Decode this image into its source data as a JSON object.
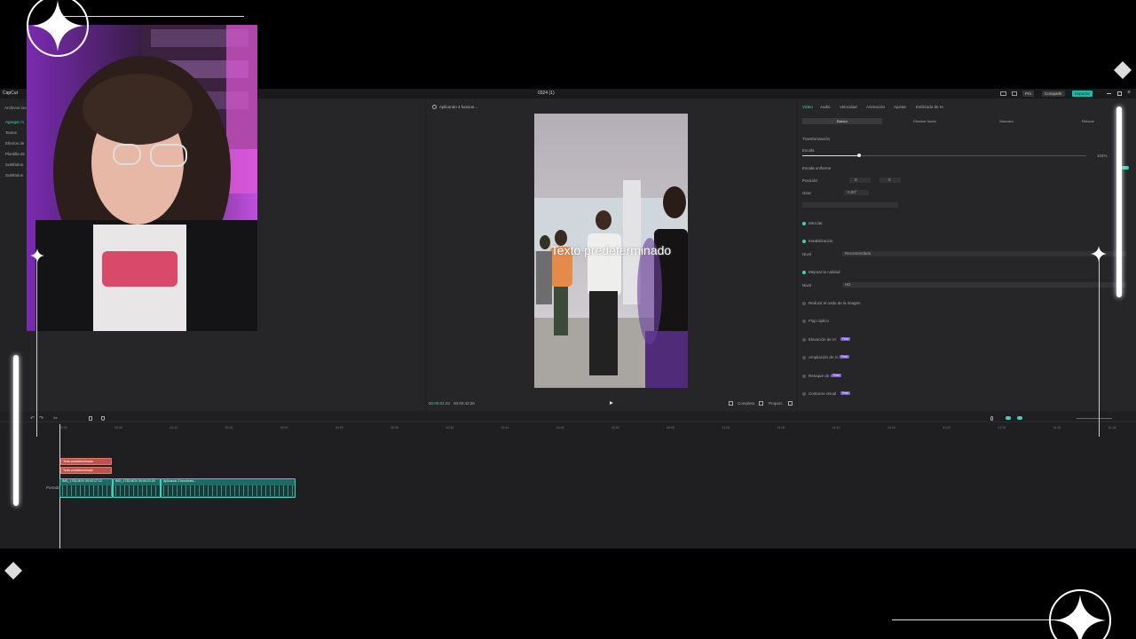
{
  "app": {
    "title": "0324 (1)",
    "logo": "CapCut",
    "share_label": "Compartir",
    "export_label": "Exportar",
    "pro_label": "Pro",
    "accent": "#3fd0c0"
  },
  "leftnav": {
    "top_label": "Archivos locales",
    "items": [
      {
        "label": "Agregar m",
        "active": true
      },
      {
        "label": "Textos",
        "active": false
      },
      {
        "label": "Efectos de",
        "active": false
      },
      {
        "label": "Plantilla de",
        "active": false
      },
      {
        "label": "Subtítulos",
        "active": false
      },
      {
        "label": "Subtítulos",
        "active": false
      }
    ]
  },
  "player": {
    "status": "Aplicando 4 funcion...",
    "overlay_text": "Texto predeterminado",
    "timecode_current": "00:00:02:23",
    "timecode_total": "00:00:42:26",
    "ratio_label": "Proporc.",
    "quality_label": "Completo"
  },
  "props": {
    "tabs": [
      {
        "label": "Vídeo",
        "active": true
      },
      {
        "label": "Audio",
        "active": false
      },
      {
        "label": "Velocidad",
        "active": false
      },
      {
        "label": "Animación",
        "active": false
      },
      {
        "label": "Ajustar",
        "active": false
      },
      {
        "label": "Estilizado de IA",
        "active": false
      }
    ],
    "subtabs": [
      {
        "label": "Básico",
        "active": true
      },
      {
        "label": "Eliminar fondo",
        "active": false
      },
      {
        "label": "Máscara",
        "active": false
      },
      {
        "label": "Retocar",
        "active": false
      }
    ],
    "transform_label": "Transformación",
    "scale_label": "Escala",
    "scale_value": "104%",
    "scale_fraction": 0.2,
    "uniform_scale_label": "Escala uniforme",
    "position_label": "Posición",
    "position_x": "0",
    "position_y": "0",
    "rotate_label": "Girar",
    "rotate_value": "0.00°",
    "blend_label": "Mezclar",
    "stabilize_label": "Estabilización",
    "level_label": "Nivel",
    "stabilize_level": "Recomendado",
    "quality_label": "Mejorar la calidad",
    "quality_level": "HD",
    "noise_label": "Reducir el ruido de la imagen",
    "flicker_label": "Flujo óptico",
    "ai_elevate_label": "Elevación de IA",
    "ai_expand_label": "Ampliación de IA",
    "ai_retouch_label": "Retoque de IA",
    "visual_label": "Contorno visual",
    "pill_label": "Free"
  },
  "timeline": {
    "ticks": [
      "00:00",
      "00:05",
      "00:10",
      "00:15",
      "00:20",
      "00:25",
      "00:30",
      "00:35",
      "00:40",
      "00:45",
      "00:50",
      "00:55",
      "01:00",
      "01:05",
      "01:10",
      "01:15",
      "01:20",
      "01:25",
      "01:30",
      "01:35"
    ],
    "text_clip_1": "Texto predeterminado",
    "text_clip_2": "Texto predeterminado",
    "video_clip_1": "IMG_1753.MOV 00:00:17:13",
    "video_clip_2": "IMG_1753.MOV 00:00:21:20",
    "video_clip_3": "Aplicando 3 funciones...",
    "cover_label": "Portada"
  }
}
